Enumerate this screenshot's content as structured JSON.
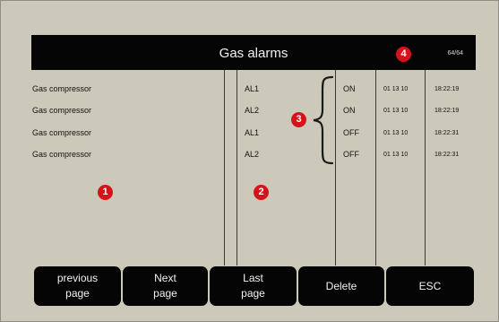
{
  "header": {
    "title": "Gas alarms",
    "page_counter": "64/64"
  },
  "alarms": [
    {
      "source": "Gas compressor",
      "code": "AL1",
      "state": "ON",
      "date": "01 13 10",
      "time": "18:22:19"
    },
    {
      "source": "Gas compressor",
      "code": "AL2",
      "state": "ON",
      "date": "01 13 10",
      "time": "18:22:19"
    },
    {
      "source": "Gas compressor",
      "code": "AL1",
      "state": "OFF",
      "date": "01 13 10",
      "time": "18:22:31"
    },
    {
      "source": "Gas compressor",
      "code": "AL2",
      "state": "OFF",
      "date": "01 13 10",
      "time": "18:22:31"
    }
  ],
  "callouts": [
    "1",
    "2",
    "3",
    "4"
  ],
  "buttons": {
    "previous": "previous\npage",
    "next": "Next\npage",
    "last": "Last\npage",
    "delete": "Delete",
    "esc": "ESC"
  },
  "colors": {
    "panel_background": "#ccc9ba",
    "bar": "#050505",
    "callout": "#d4141a"
  }
}
